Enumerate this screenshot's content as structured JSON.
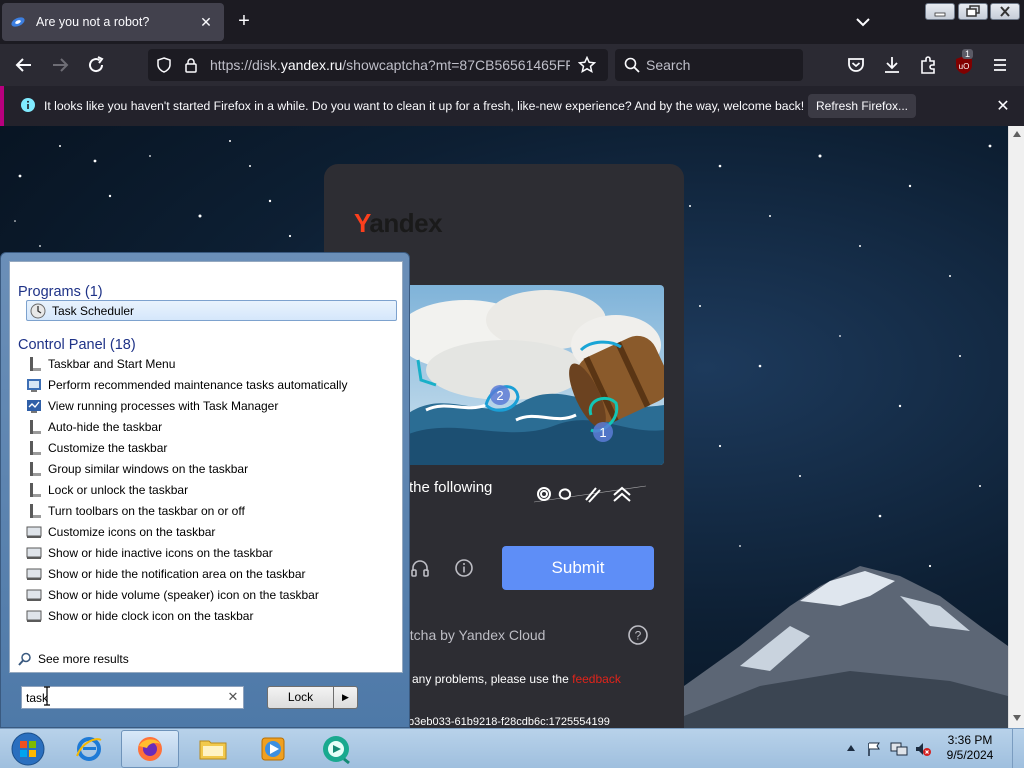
{
  "browser": {
    "tab_title": "Are you not a robot?",
    "url_prefix": "https://disk.",
    "url_domain": "yandex.ru",
    "url_rest": "/showcaptcha?mt=87CB56561465FF",
    "search_placeholder": "Search",
    "notification_badge": "1"
  },
  "notification": {
    "text": "It looks like you haven't started Firefox in a while. Do you want to clean it up for a fresh, like-new experience? And by the way, welcome back!",
    "button": "Refresh Firefox..."
  },
  "captcha": {
    "logo_y": "Y",
    "logo_rest": "andex",
    "instruction": "the following",
    "submit": "Submit",
    "by_line": "otcha by Yandex Cloud",
    "problems_prefix": "e any problems, please use the",
    "feedback_link": "feedback",
    "token": "b3eb033-61b9218-f28cdb6c:1725554199",
    "image_markers": [
      "1",
      "2"
    ]
  },
  "start_menu": {
    "programs_heading": "Programs",
    "programs_count": "(1)",
    "programs": [
      {
        "label": "Task Scheduler"
      }
    ],
    "control_panel_heading": "Control Panel",
    "control_panel_count": "(18)",
    "control_panel": [
      {
        "label": "Taskbar and Start Menu"
      },
      {
        "label": "Perform recommended maintenance tasks automatically"
      },
      {
        "label": "View running processes with Task Manager"
      },
      {
        "label": "Auto-hide the taskbar"
      },
      {
        "label": "Customize the taskbar"
      },
      {
        "label": "Group similar windows on the taskbar"
      },
      {
        "label": "Lock or unlock the taskbar"
      },
      {
        "label": "Turn toolbars on the taskbar on or off"
      },
      {
        "label": "Customize icons on the taskbar"
      },
      {
        "label": "Show or hide inactive icons on the taskbar"
      },
      {
        "label": "Show or hide the notification area on the taskbar"
      },
      {
        "label": "Show or hide volume (speaker) icon on the taskbar"
      },
      {
        "label": "Show or hide clock icon on the taskbar"
      }
    ],
    "see_more": "See more results",
    "search_value": "task",
    "lock_button": "Lock"
  },
  "taskbar": {
    "time": "3:36 PM",
    "date": "9/5/2024"
  },
  "colors": {
    "firefox_dark": "#1c1b22",
    "notif_accent": "#b8007e",
    "submit_blue": "#5e8ef7",
    "yandex_red": "#fc3f1d",
    "feedback_red": "#e0241b",
    "start_heading": "#1e3287"
  }
}
